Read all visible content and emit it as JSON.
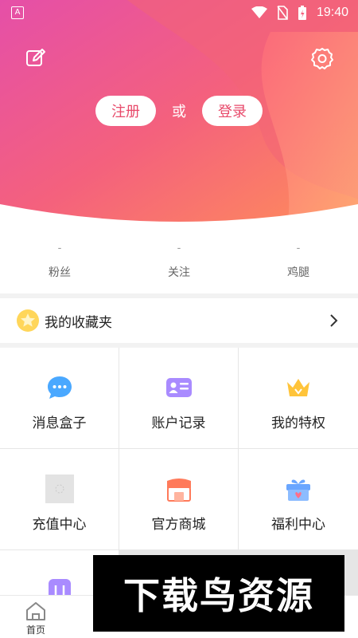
{
  "status_bar": {
    "time": "19:40",
    "app_indicator": "A"
  },
  "header": {
    "register_label": "注册",
    "or_label": "或",
    "login_label": "登录",
    "gradient_colors": [
      "#e84a8f",
      "#ff8a4a"
    ]
  },
  "stats": [
    {
      "value": "-",
      "label": "粉丝"
    },
    {
      "value": "-",
      "label": "关注"
    },
    {
      "value": "-",
      "label": "鸡腿"
    }
  ],
  "favorites": {
    "label": "我的收藏夹"
  },
  "grid": [
    {
      "label": "消息盒子",
      "icon": "chat-bubble-icon",
      "color": "#4aa8ff"
    },
    {
      "label": "账户记录",
      "icon": "id-card-icon",
      "color": "#a98bff"
    },
    {
      "label": "我的特权",
      "icon": "crown-icon",
      "color": "#ffc43a"
    },
    {
      "label": "充值中心",
      "icon": "image-placeholder-icon",
      "color": "#dddddd"
    },
    {
      "label": "官方商城",
      "icon": "shop-icon",
      "color": "#ff7a5a"
    },
    {
      "label": "福利中心",
      "icon": "gift-icon",
      "color": "#6aa6ff"
    }
  ],
  "bottom_nav": {
    "home_label": "首页"
  },
  "watermark": {
    "text": "下载鸟资源"
  }
}
